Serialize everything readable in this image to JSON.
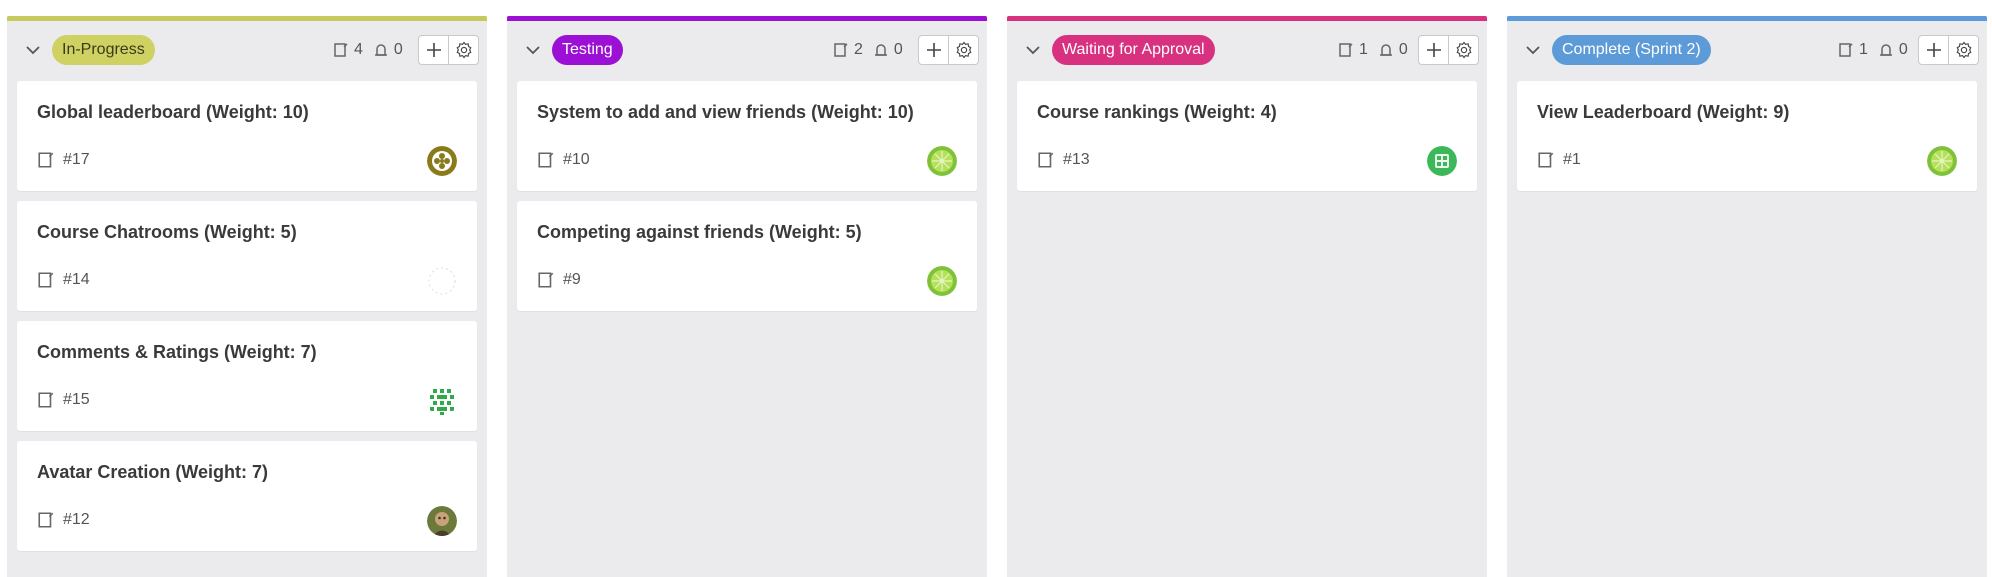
{
  "columns": [
    {
      "label": "In-Progress",
      "bar_color": "#c6c95b",
      "badge_bg": "#cfd163",
      "badge_fg": "#3a3a1a",
      "issue_count": "4",
      "pr_count": "0",
      "cards": [
        {
          "title": "Global leaderboard (Weight: 10)",
          "number": "#17",
          "avatar": "gear-olive"
        },
        {
          "title": "Course Chatrooms (Weight: 5)",
          "number": "#14",
          "avatar": "empty"
        },
        {
          "title": "Comments & Ratings (Weight: 7)",
          "number": "#15",
          "avatar": "identicon-green"
        },
        {
          "title": "Avatar Creation (Weight: 7)",
          "number": "#12",
          "avatar": "photo"
        }
      ]
    },
    {
      "label": "Testing",
      "bar_color": "#9b10d4",
      "badge_bg": "#9b10d4",
      "badge_fg": "#ffffff",
      "issue_count": "2",
      "pr_count": "0",
      "cards": [
        {
          "title": "System to add and view friends (Weight: 10)",
          "number": "#10",
          "avatar": "lime"
        },
        {
          "title": "Competing against friends (Weight: 5)",
          "number": "#9",
          "avatar": "lime"
        }
      ]
    },
    {
      "label": "Waiting for Approval",
      "bar_color": "#d8317f",
      "badge_bg": "#d8317f",
      "badge_fg": "#ffffff",
      "issue_count": "1",
      "pr_count": "0",
      "cards": [
        {
          "title": "Course rankings (Weight: 4)",
          "number": "#13",
          "avatar": "green-grid"
        }
      ]
    },
    {
      "label": "Complete (Sprint 2)",
      "bar_color": "#5d9bd8",
      "badge_bg": "#5d9bd8",
      "badge_fg": "#ffffff",
      "issue_count": "1",
      "pr_count": "0",
      "cards": [
        {
          "title": "View Leaderboard (Weight: 9)",
          "number": "#1",
          "avatar": "lime"
        }
      ]
    }
  ],
  "icons": {
    "collapse": "chevron-down-icon",
    "issues": "issue-icon",
    "pull_requests": "pull-request-icon",
    "add": "plus-icon",
    "settings": "gear-icon"
  }
}
